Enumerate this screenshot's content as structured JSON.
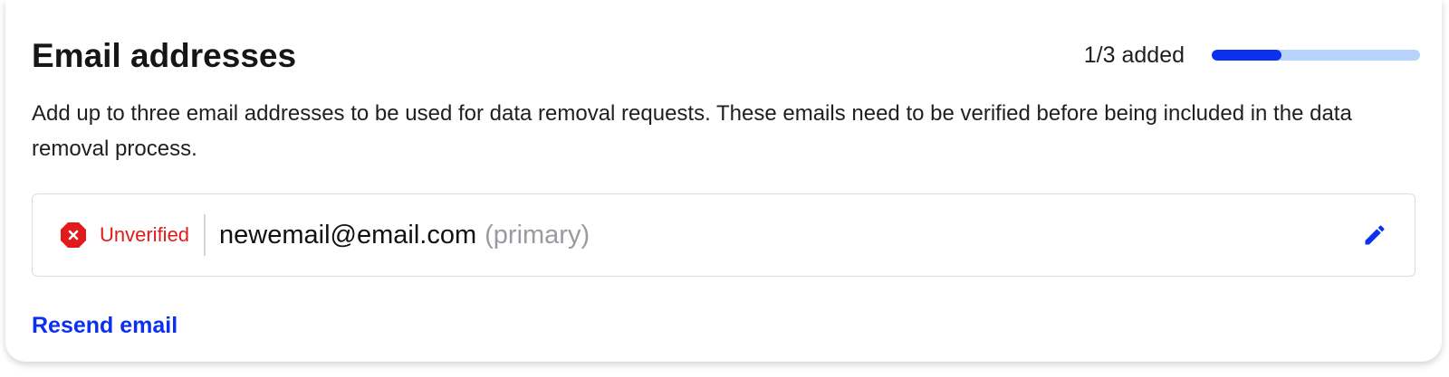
{
  "section": {
    "title": "Email addresses",
    "description": "Add up to three email addresses to be used for data removal requests. These emails need to be verified before being included in the data removal process."
  },
  "progress": {
    "label": "1/3 added",
    "fraction": 0.3333,
    "fill_color": "#0b30f0",
    "track_color": "#b6d4fb"
  },
  "emails": [
    {
      "status_icon": "x-octagon-icon",
      "status_label": "Unverified",
      "status_color": "#e11b1b",
      "address": "newemail@email.com",
      "tag": "(primary)",
      "edit_icon": "pencil-icon"
    }
  ],
  "actions": {
    "resend_label": "Resend email",
    "link_color": "#0b30f0"
  }
}
